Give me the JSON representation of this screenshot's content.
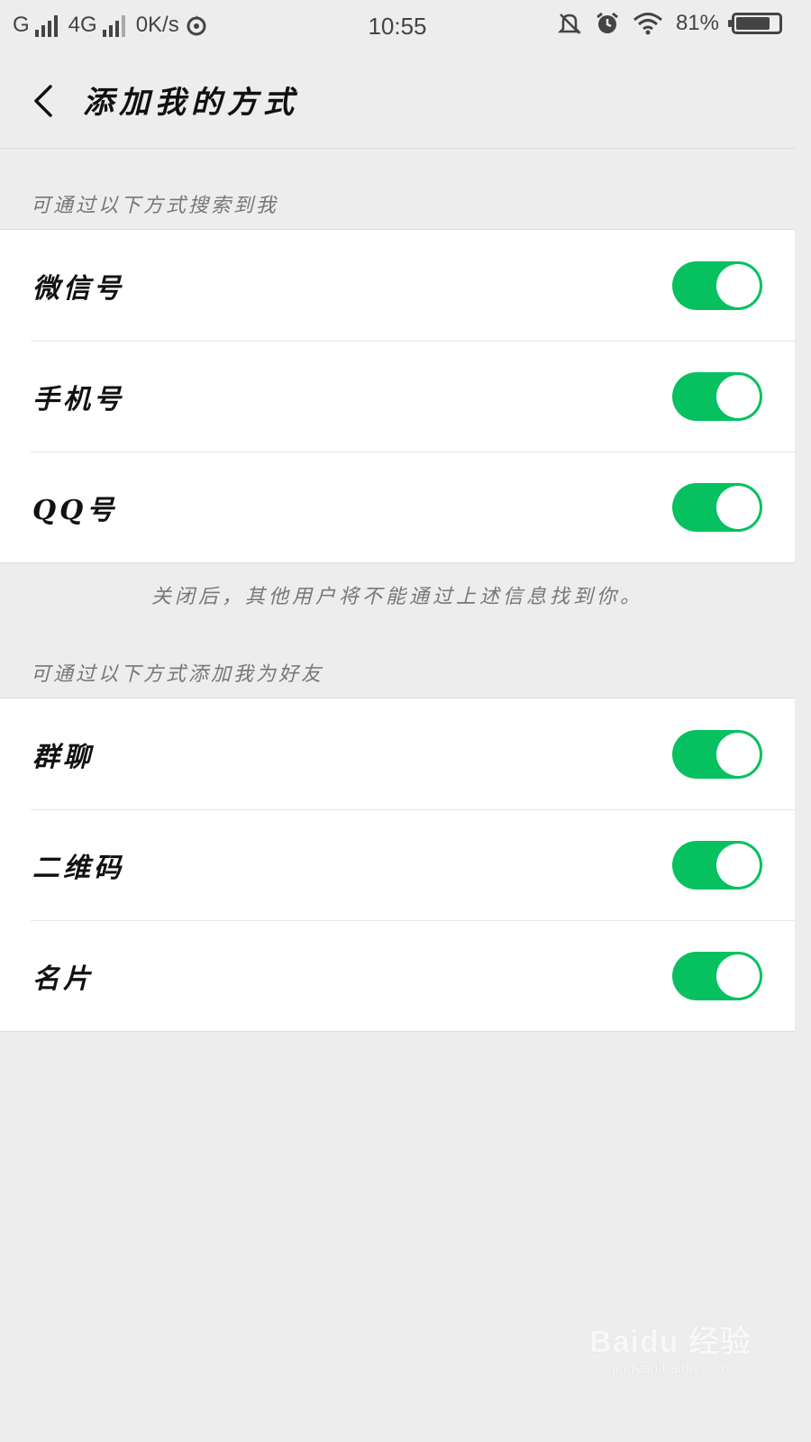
{
  "status_bar": {
    "carrier1": "G",
    "carrier2": "4G",
    "speed": "0K/s",
    "time": "10:55",
    "battery": "81%",
    "battery_level": 0.81,
    "icons": [
      "signal-icon",
      "sync-icon",
      "mute-icon",
      "alarm-icon",
      "wifi-icon",
      "battery-icon"
    ]
  },
  "header": {
    "title": "添加我的方式",
    "back_icon": "chevron-left-icon"
  },
  "search_section": {
    "label": "可通过以下方式搜索到我",
    "items": [
      {
        "label": "微信号",
        "enabled": true
      },
      {
        "label": "手机号",
        "enabled": true
      },
      {
        "label": "QQ号",
        "enabled": true
      }
    ],
    "note": "关闭后，其他用户将不能通过上述信息找到你。"
  },
  "add_section": {
    "label": "可通过以下方式添加我为好友",
    "items": [
      {
        "label": "群聊",
        "enabled": true
      },
      {
        "label": "二维码",
        "enabled": true
      },
      {
        "label": "名片",
        "enabled": true
      }
    ]
  },
  "watermark": {
    "logo": "Baidu 经验",
    "url": "jingyan.baidu.com"
  },
  "colors": {
    "toggle_on": "#07c160",
    "background": "#ededed"
  }
}
